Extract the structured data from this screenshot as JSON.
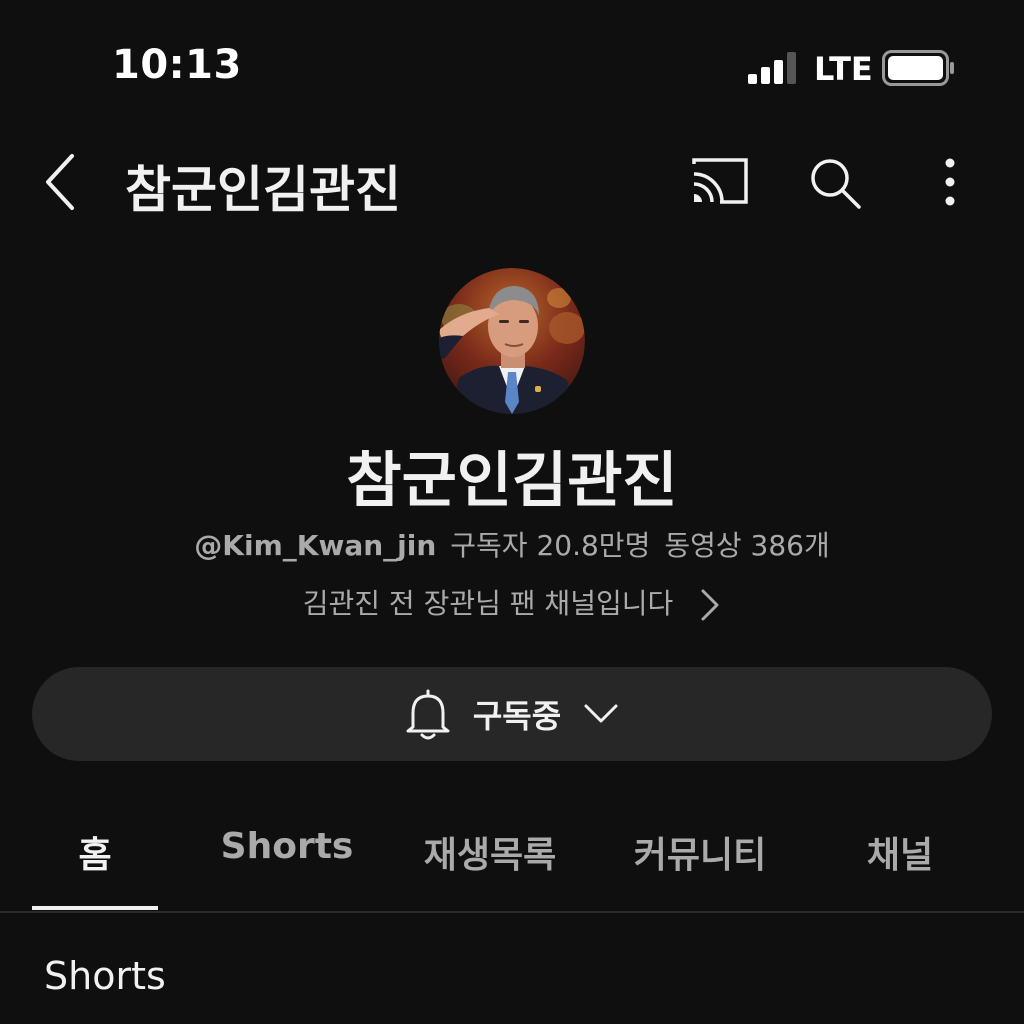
{
  "status_bar": {
    "time": "10:13",
    "network": "LTE"
  },
  "header": {
    "title": "참군인김관진",
    "icons": [
      "back-icon",
      "cast-icon",
      "search-icon",
      "more-vert-icon"
    ]
  },
  "channel": {
    "name": "참군인김관진",
    "handle": "@Kim_Kwan_jin",
    "subscribers": "구독자 20.8만명",
    "videos": "동영상 386개",
    "description": "김관진 전 장관님 팬 채널입니다"
  },
  "subscribe": {
    "label": "구독중"
  },
  "tabs": [
    {
      "label": "홈",
      "active": true
    },
    {
      "label": "Shorts",
      "active": false
    },
    {
      "label": "재생목록",
      "active": false
    },
    {
      "label": "커뮤니티",
      "active": false
    },
    {
      "label": "채널",
      "active": false
    }
  ],
  "section": {
    "title": "Shorts"
  },
  "colors": {
    "background": "#0f0f0f",
    "pill": "#272727",
    "text_primary": "#f1f1f1",
    "text_secondary": "#aaaaaa"
  }
}
